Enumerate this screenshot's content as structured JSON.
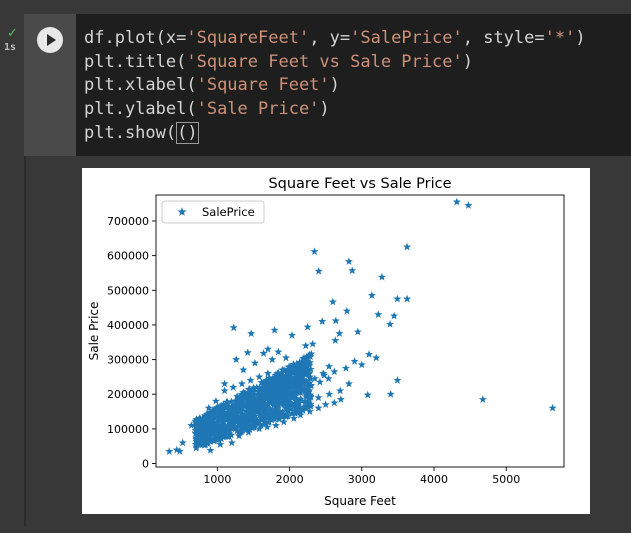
{
  "cell": {
    "status_icon": "check-icon",
    "exec_time": "1s",
    "run_icon": "play-icon",
    "code_lines": [
      {
        "parts": [
          [
            "plain",
            "df.plot(x="
          ],
          [
            "str",
            "'SquareFeet'"
          ],
          [
            "plain",
            ", y="
          ],
          [
            "str",
            "'SalePrice'"
          ],
          [
            "plain",
            ", style="
          ],
          [
            "str",
            "'*'"
          ],
          [
            "plain",
            ")"
          ]
        ]
      },
      {
        "parts": [
          [
            "plain",
            "plt.title("
          ],
          [
            "str",
            "'Square Feet vs Sale Price'"
          ],
          [
            "plain",
            ")"
          ]
        ]
      },
      {
        "parts": [
          [
            "plain",
            "plt.xlabel("
          ],
          [
            "str",
            "'Square Feet'"
          ],
          [
            "plain",
            ")"
          ]
        ]
      },
      {
        "parts": [
          [
            "plain",
            "plt.ylabel("
          ],
          [
            "str",
            "'Sale Price'"
          ],
          [
            "plain",
            ")"
          ]
        ]
      },
      {
        "parts": [
          [
            "plain",
            "plt.show("
          ],
          [
            "cursor",
            "()"
          ]
        ]
      }
    ]
  },
  "colors": {
    "marker": "#1f77b4",
    "string": "#ce9178",
    "code_text": "#d4d4d4",
    "success": "#5bb85b"
  },
  "chart_data": {
    "type": "scatter",
    "title": "Square Feet vs Sale Price",
    "xlabel": "Square Feet",
    "ylabel": "Sale Price",
    "legend": [
      "SalePrice"
    ],
    "legend_position": "top-left",
    "marker": "*",
    "xlim": [
      150,
      5800
    ],
    "ylim": [
      -10000,
      775000
    ],
    "xticks": [
      1000,
      2000,
      3000,
      4000,
      5000
    ],
    "xtick_labels": [
      "1000",
      "2000",
      "3000",
      "4000",
      "5000"
    ],
    "yticks": [
      0,
      100000,
      200000,
      300000,
      400000,
      500000,
      600000,
      700000
    ],
    "ytick_labels": [
      "0",
      "100000",
      "200000",
      "300000",
      "400000",
      "500000",
      "600000",
      "700000"
    ],
    "series": [
      {
        "name": "SalePrice",
        "x": [
          4316,
          4476,
          3627,
          2345,
          2822,
          2868,
          2403,
          3279,
          3493,
          3140,
          3627,
          2599,
          2794,
          3228,
          3447,
          2640,
          2452,
          1226,
          2250,
          3391,
          1792,
          1468,
          2690,
          2034,
          2945,
          2633,
          2320,
          2224,
          1700,
          1844,
          1640,
          4676,
          5642,
          3400,
          3082,
          2822,
          3493,
          2466,
          2546,
          2200,
          1950,
          1520,
          1360,
          1100,
          980,
          880,
          760,
          700,
          640,
          520,
          438,
          334,
          480,
          904,
          1040,
          1200,
          1300,
          1430,
          1580,
          1690,
          1810,
          1920,
          2060,
          2150,
          2280,
          2400,
          2500,
          2620,
          2710,
          1150,
          1240,
          1350,
          1480,
          1560,
          1620,
          1740,
          1880,
          2010,
          2130,
          1080,
          960,
          840,
          1010,
          1110,
          1210,
          1320,
          1420,
          1520,
          1610,
          1710,
          1820,
          1930,
          2040,
          2160,
          2280,
          1700,
          1580,
          1460,
          1340,
          1220,
          1100,
          1500,
          1650,
          1800,
          1950,
          2100,
          2250,
          2400,
          2550,
          2700,
          1900,
          2050,
          2200,
          1760,
          1420,
          1260,
          1680,
          1840,
          2000,
          2120,
          920,
          1000,
          1180,
          1280,
          1380,
          1480,
          1580,
          1680,
          1780,
          1880,
          1980,
          2080,
          2180,
          2300,
          2420,
          2540,
          1300,
          1400,
          1500,
          1600,
          1700,
          1800,
          1900,
          1200,
          1360,
          1520,
          1640,
          1780,
          1920,
          1060,
          860,
          780,
          1160,
          1320,
          1440,
          1560,
          1720,
          1860,
          1990,
          2090,
          2210,
          2350,
          2480,
          2620,
          2780,
          3000,
          2900,
          3200,
          3100,
          1250,
          1450,
          1650,
          1850,
          2050,
          1350,
          1550,
          1750,
          1950,
          2150,
          1050,
          1150,
          1250,
          1350,
          1450,
          1550,
          1650,
          1750,
          1850,
          1950
        ],
        "y": [
          755000,
          745000,
          625000,
          611657,
          582933,
          556581,
          555000,
          538000,
          475000,
          485000,
          475000,
          466500,
          440000,
          430000,
          426000,
          412000,
          410000,
          392000,
          394000,
          402000,
          385000,
          375000,
          375000,
          369900,
          380000,
          355000,
          345000,
          340000,
          330000,
          322000,
          318000,
          184750,
          160000,
          200000,
          198000,
          230000,
          240000,
          260000,
          280000,
          300000,
          305000,
          290000,
          270000,
          230000,
          180000,
          160000,
          130000,
          120000,
          110000,
          60000,
          39300,
          34900,
          35311,
          37900,
          55000,
          60000,
          80000,
          90000,
          100000,
          105000,
          110000,
          120000,
          130000,
          140000,
          150000,
          160000,
          170000,
          175000,
          185000,
          140000,
          150000,
          160000,
          170000,
          180000,
          190000,
          200000,
          210000,
          220000,
          230000,
          120000,
          110000,
          100000,
          130000,
          140000,
          150000,
          160000,
          170000,
          180000,
          190000,
          200000,
          210000,
          220000,
          230000,
          240000,
          250000,
          260000,
          250000,
          240000,
          230000,
          220000,
          210000,
          130000,
          140000,
          150000,
          160000,
          170000,
          180000,
          190000,
          200000,
          210000,
          270000,
          280000,
          290000,
          300000,
          320000,
          300000,
          240000,
          250000,
          260000,
          270000,
          95000,
          105000,
          115000,
          125000,
          135000,
          145000,
          155000,
          165000,
          175000,
          185000,
          195000,
          205000,
          215000,
          225000,
          235000,
          245000,
          185000,
          195000,
          205000,
          215000,
          225000,
          235000,
          245000,
          165000,
          175000,
          185000,
          195000,
          205000,
          215000,
          145000,
          125000,
          115000,
          155000,
          165000,
          175000,
          185000,
          195000,
          205000,
          215000,
          225000,
          235000,
          245000,
          255000,
          265000,
          275000,
          285000,
          295000,
          305000,
          315000,
          180000,
          200000,
          220000,
          240000,
          260000,
          110000,
          120000,
          130000,
          140000,
          150000,
          90000,
          95000,
          100000,
          105000,
          110000,
          115000,
          120000,
          125000,
          130000,
          135000
        ]
      }
    ]
  }
}
